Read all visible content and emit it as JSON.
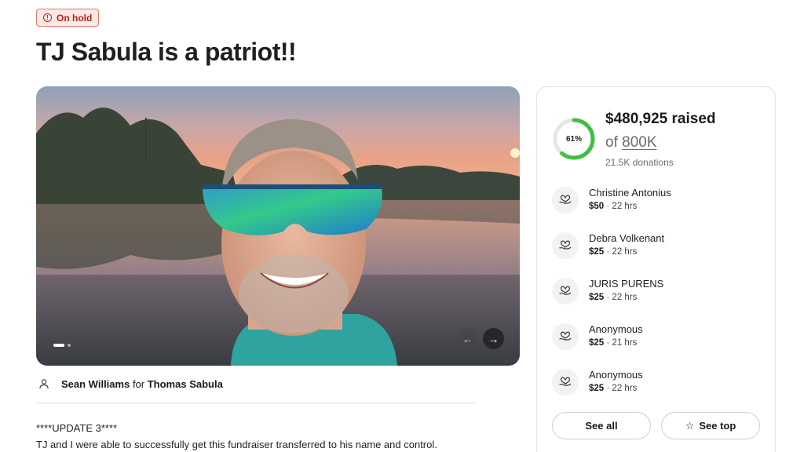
{
  "status_badge": {
    "label": "On hold",
    "icon": "info-icon",
    "color": "#b3261e"
  },
  "title": "TJ Sabula is a patriot!!",
  "organizer": {
    "name": "Sean Williams",
    "connector": "for",
    "beneficiary": "Thomas Sabula"
  },
  "story": {
    "line1": "****UPDATE 3****",
    "line2": "TJ and I were able to successfully get this fundraiser transferred to his name and control."
  },
  "carousel": {
    "slide": 1,
    "slides": 2,
    "prev_icon": "arrow-left-icon",
    "next_icon": "arrow-right-icon"
  },
  "donation_card": {
    "raised": "$480,925 raised",
    "goal_prefix": "of",
    "goal": "800K",
    "donations": "21.5K donations",
    "progress_label": "61%",
    "progress_fraction": 0.61,
    "progress_color": "#3fbf3f",
    "donors": [
      {
        "name": "Christine Antonius",
        "amount": "$50",
        "time": "22 hrs"
      },
      {
        "name": "Debra Volkenant",
        "amount": "$25",
        "time": "22 hrs"
      },
      {
        "name": "JURIS PURENS",
        "amount": "$25",
        "time": "22 hrs"
      },
      {
        "name": "Anonymous",
        "amount": "$25",
        "time": "21 hrs"
      },
      {
        "name": "Anonymous",
        "amount": "$25",
        "time": "22 hrs"
      }
    ],
    "see_all_label": "See all",
    "see_top_label": "See top"
  }
}
